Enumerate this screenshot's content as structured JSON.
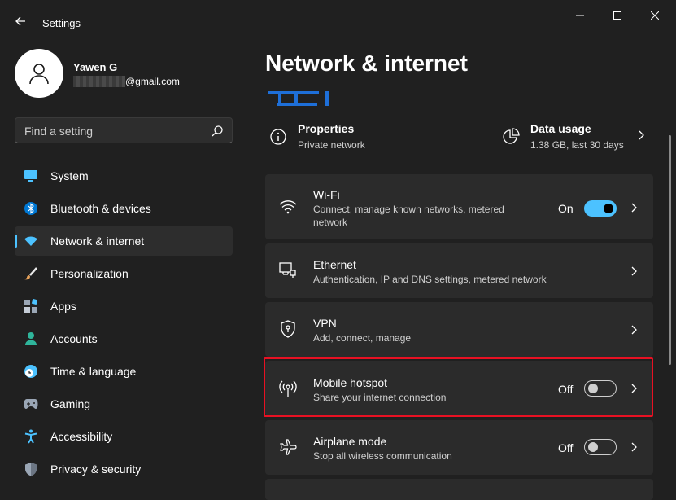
{
  "window": {
    "title": "Settings"
  },
  "profile": {
    "name": "Yawen G",
    "email_suffix": "@gmail.com"
  },
  "search": {
    "placeholder": "Find a setting"
  },
  "sidebar": {
    "items": [
      {
        "label": "System",
        "icon": "monitor-icon",
        "color": "#4cc2ff"
      },
      {
        "label": "Bluetooth & devices",
        "icon": "bluetooth-icon",
        "color": "#0078d4"
      },
      {
        "label": "Network & internet",
        "icon": "wifi-icon",
        "color": "#4cc2ff",
        "active": true
      },
      {
        "label": "Personalization",
        "icon": "brush-icon",
        "color": "#e8a25a"
      },
      {
        "label": "Apps",
        "icon": "apps-icon",
        "color": "#9aa6b5"
      },
      {
        "label": "Accounts",
        "icon": "person-icon",
        "color": "#2fb59b"
      },
      {
        "label": "Time & language",
        "icon": "clock-globe-icon",
        "color": "#4cc2ff"
      },
      {
        "label": "Gaming",
        "icon": "gamepad-icon",
        "color": "#9aa6b5"
      },
      {
        "label": "Accessibility",
        "icon": "accessibility-icon",
        "color": "#4cc2ff"
      },
      {
        "label": "Privacy & security",
        "icon": "shield-icon",
        "color": "#9aa6b5"
      }
    ]
  },
  "main": {
    "title": "Network & internet",
    "properties": {
      "title": "Properties",
      "subtitle": "Private network"
    },
    "data_usage": {
      "title": "Data usage",
      "subtitle": "1.38 GB, last 30 days"
    },
    "cards": [
      {
        "title": "Wi-Fi",
        "desc": "Connect, manage known networks, metered network",
        "state": "On",
        "toggle": "on",
        "icon": "wifi-icon"
      },
      {
        "title": "Ethernet",
        "desc": "Authentication, IP and DNS settings, metered network",
        "icon": "ethernet-icon"
      },
      {
        "title": "VPN",
        "desc": "Add, connect, manage",
        "icon": "vpn-shield-icon"
      },
      {
        "title": "Mobile hotspot",
        "desc": "Share your internet connection",
        "state": "Off",
        "toggle": "off",
        "icon": "hotspot-icon"
      },
      {
        "title": "Airplane mode",
        "desc": "Stop all wireless communication",
        "state": "Off",
        "toggle": "off",
        "icon": "airplane-icon"
      }
    ]
  },
  "colors": {
    "accent": "#4cc2ff",
    "highlight": "#e81123",
    "background": "#202020",
    "card": "#2b2b2b"
  }
}
